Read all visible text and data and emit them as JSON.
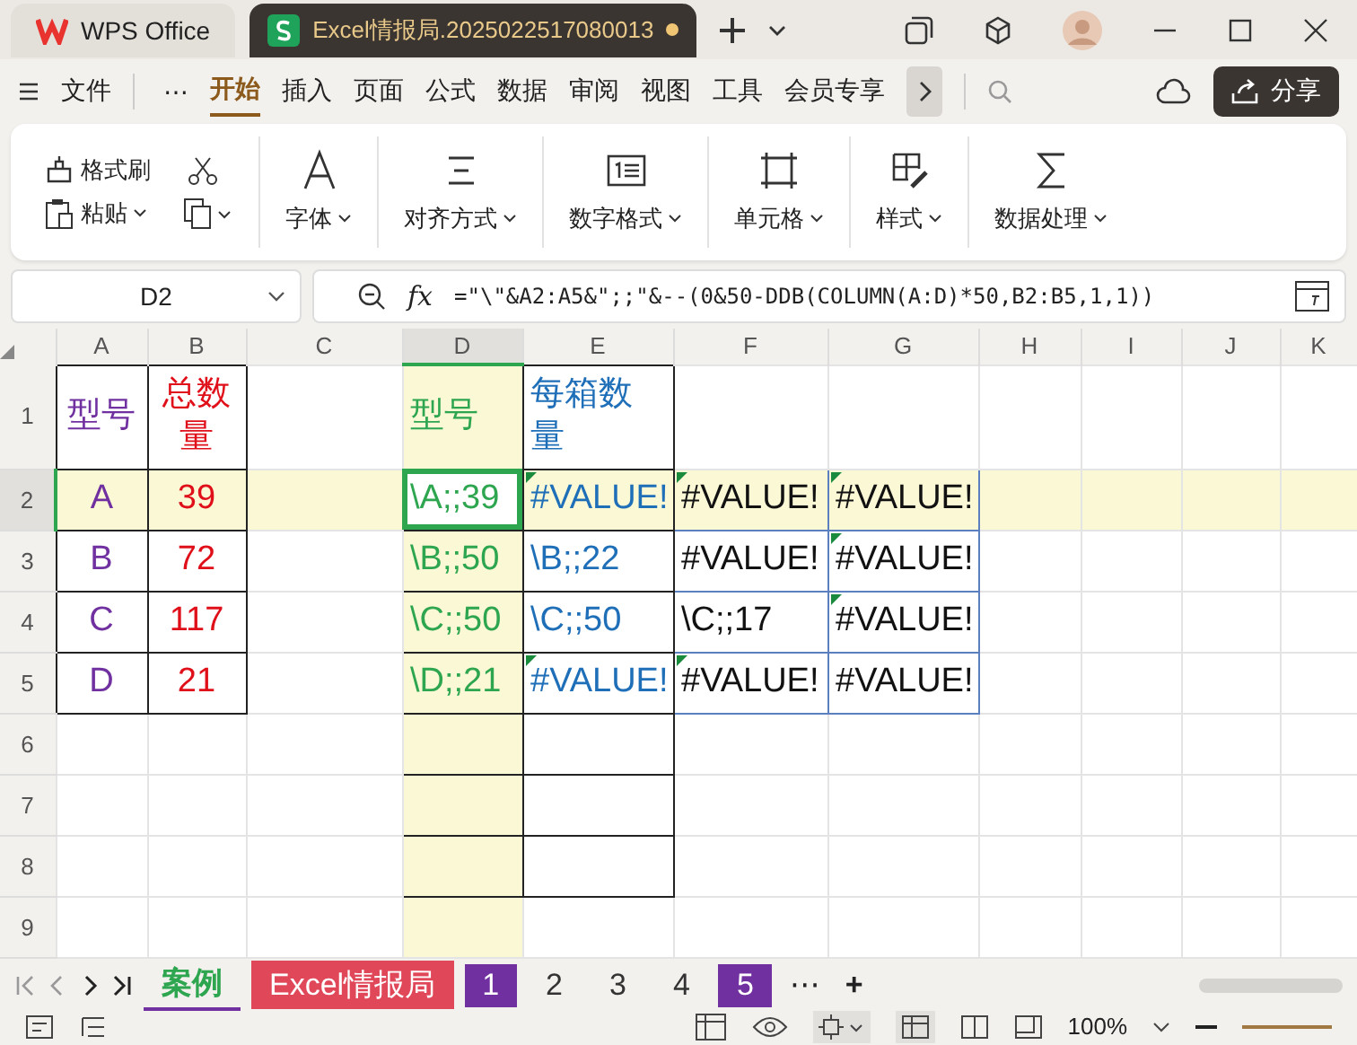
{
  "title_bar": {
    "tabs": [
      {
        "label": "WPS Office",
        "selected": false,
        "unsaved": false
      },
      {
        "label": "Excel情报局.2025022517080013",
        "selected": true,
        "unsaved": true
      }
    ]
  },
  "menu_bar": {
    "file": "文件",
    "more": "⋯",
    "tabs": [
      {
        "label": "开始",
        "selected": true
      },
      {
        "label": "插入",
        "selected": false
      },
      {
        "label": "页面",
        "selected": false
      },
      {
        "label": "公式",
        "selected": false
      },
      {
        "label": "数据",
        "selected": false
      },
      {
        "label": "审阅",
        "selected": false
      },
      {
        "label": "视图",
        "selected": false
      },
      {
        "label": "工具",
        "selected": false
      },
      {
        "label": "会员专享",
        "selected": false
      }
    ],
    "share": "分享"
  },
  "ribbon": {
    "clipboard": [
      "格式刷",
      "粘贴"
    ],
    "groups": [
      "字体",
      "对齐方式",
      "数字格式",
      "单元格",
      "样式",
      "数据处理"
    ]
  },
  "formula_bar": {
    "name_box": "D2",
    "fx": "fx",
    "formula": "=\"\\\"&A2:A5&\";;\"&--(0&50-DDB(COLUMN(A:D)*50,B2:B5,1,1))"
  },
  "columns": [
    {
      "label": "A",
      "selected": false
    },
    {
      "label": "B",
      "selected": false
    },
    {
      "label": "C",
      "selected": false
    },
    {
      "label": "D",
      "selected": true
    },
    {
      "label": "E",
      "selected": false
    },
    {
      "label": "F",
      "selected": false
    },
    {
      "label": "G",
      "selected": false
    },
    {
      "label": "H",
      "selected": false
    },
    {
      "label": "I",
      "selected": false
    },
    {
      "label": "J",
      "selected": false
    },
    {
      "label": "K",
      "selected": false
    }
  ],
  "rows": [
    {
      "label": "1",
      "selected": false,
      "cells": [
        {
          "text": "型号",
          "color": "#7030a0"
        },
        {
          "text": "总数量",
          "color": "#e0101a"
        },
        {},
        {
          "text": "型号",
          "color": "#2ea54f"
        },
        {
          "text": "每箱数量",
          "color": "#1f6fb8"
        },
        {},
        {}
      ]
    },
    {
      "label": "2",
      "selected": true,
      "cells": [
        {
          "text": "A",
          "color": "#7030a0"
        },
        {
          "text": "39",
          "color": "#e0101a"
        },
        {},
        {
          "text": "\\A;;39",
          "color": "#2ea54f",
          "selected": true
        },
        {
          "text": "#VALUE!",
          "color": "#1f6fb8",
          "flag": true
        },
        {
          "text": "#VALUE!",
          "color": "#111111",
          "flag": true
        },
        {
          "text": "#VALUE!",
          "color": "#111111",
          "flag": true
        }
      ]
    },
    {
      "label": "3",
      "selected": false,
      "cells": [
        {
          "text": "B",
          "color": "#7030a0"
        },
        {
          "text": "72",
          "color": "#e0101a"
        },
        {},
        {
          "text": "\\B;;50",
          "color": "#2ea54f"
        },
        {
          "text": "\\B;;22",
          "color": "#1f6fb8"
        },
        {
          "text": "#VALUE!",
          "color": "#111111"
        },
        {
          "text": "#VALUE!",
          "color": "#111111",
          "flag": true
        }
      ]
    },
    {
      "label": "4",
      "selected": false,
      "cells": [
        {
          "text": "C",
          "color": "#7030a0"
        },
        {
          "text": "117",
          "color": "#e0101a"
        },
        {},
        {
          "text": "\\C;;50",
          "color": "#2ea54f"
        },
        {
          "text": "\\C;;50",
          "color": "#1f6fb8"
        },
        {
          "text": "\\C;;17",
          "color": "#111111"
        },
        {
          "text": "#VALUE!",
          "color": "#111111",
          "flag": true
        }
      ]
    },
    {
      "label": "5",
      "selected": false,
      "cells": [
        {
          "text": "D",
          "color": "#7030a0"
        },
        {
          "text": "21",
          "color": "#e0101a"
        },
        {},
        {
          "text": "\\D;;21",
          "color": "#2ea54f"
        },
        {
          "text": "#VALUE!",
          "color": "#1f6fb8",
          "flag": true
        },
        {
          "text": "#VALUE!",
          "color": "#111111",
          "flag": true
        },
        {
          "text": "#VALUE!",
          "color": "#111111"
        }
      ]
    },
    {
      "label": "6",
      "selected": false,
      "cells": []
    },
    {
      "label": "7",
      "selected": false,
      "cells": []
    },
    {
      "label": "8",
      "selected": false,
      "cells": []
    },
    {
      "label": "9",
      "selected": false,
      "cells": []
    }
  ],
  "sheet_tabs": [
    {
      "label": "案例",
      "selected": true
    },
    {
      "label": "Excel情报局",
      "selected": false,
      "color": "#e0485a"
    },
    {
      "label": "1",
      "selected": false,
      "color": "#7030a0"
    },
    {
      "label": "2",
      "selected": false
    },
    {
      "label": "3",
      "selected": false
    },
    {
      "label": "4",
      "selected": false
    },
    {
      "label": "5",
      "selected": false,
      "color": "#7030a0"
    }
  ],
  "sheet_more": "⋯",
  "add_sheet": "+",
  "status_bar": {
    "zoom": "100%"
  }
}
